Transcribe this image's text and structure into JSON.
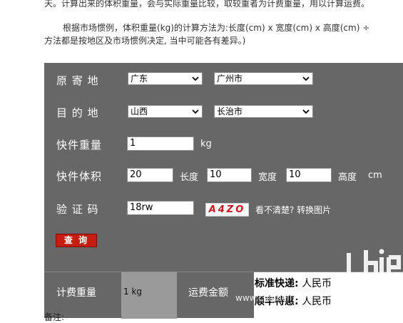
{
  "intro": {
    "top_line": "天。计算出来的体积重量，会与实际重量比较，取较重者为计费重量，用以计算运费。",
    "paragraph_line1": "根据市场惯例，体积重量(kg)的计算方法为:长度(cm) x 宽度(cm) x 高度(cm) ÷",
    "paragraph_line2": "方法都是按地区及市场惯例决定, 当中可能各有差异。)"
  },
  "form": {
    "origin": {
      "label": "原 寄 地",
      "province": "广东",
      "city": "广州市"
    },
    "destination": {
      "label": "目 的 地",
      "province": "山西",
      "city": "长治市"
    },
    "weight": {
      "label": "快件重量",
      "value": "1",
      "unit": "kg"
    },
    "volume": {
      "label": "快件体积",
      "length_value": "20",
      "length_label": "长度",
      "width_value": "10",
      "width_label": "宽度",
      "height_value": "10",
      "height_label": "高度",
      "unit": "cm"
    },
    "captcha": {
      "label": "验 证 码",
      "value": "18rw",
      "image_text": "A4ZO",
      "refresh_text": "看不清楚? 转换图片"
    },
    "query_button": "查 询"
  },
  "result": {
    "charge_weight_label": "计费重量",
    "charge_weight_value": "1 kg",
    "fee_label": "运费金额",
    "standard_label": "标准快递:",
    "standard_value": "人民币",
    "shunfeng_label": "顺丰特惠:",
    "shunfeng_value": "人民币"
  },
  "note_label": "备注:",
  "watermark_url": "www.chiphell.com",
  "colors": {
    "panel": "#676767",
    "button": "#c51d12",
    "captcha": "#c8161d"
  }
}
